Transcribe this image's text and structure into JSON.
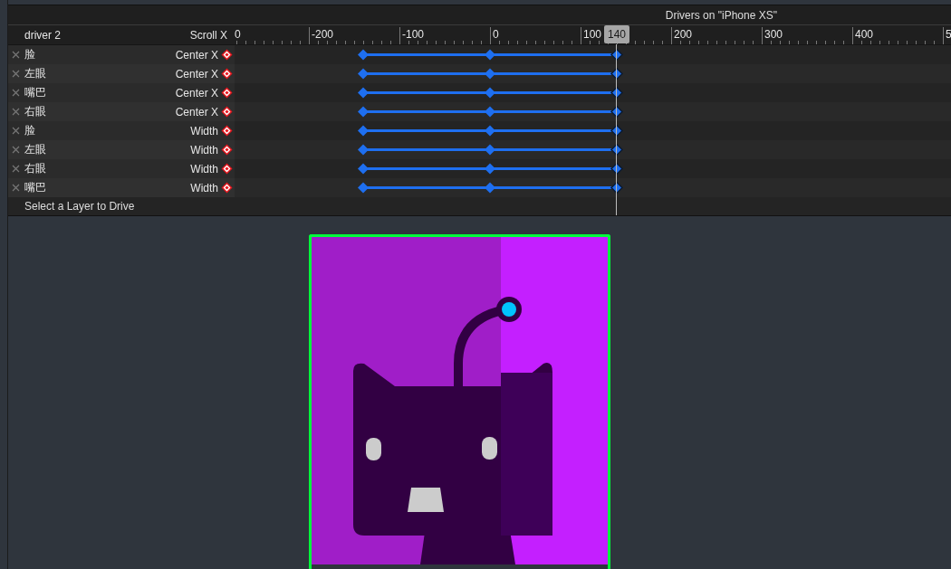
{
  "panel": {
    "title": "Drivers on \"iPhone XS\"",
    "driver": "driver 2",
    "driver_property": "Scroll X"
  },
  "ruler": {
    "labels": [
      "0",
      "-200",
      "-100",
      "0",
      "100",
      "200",
      "300",
      "400",
      "5"
    ],
    "playhead": "140"
  },
  "rows": [
    {
      "layer": "脸",
      "property": "Center X"
    },
    {
      "layer": "左眼",
      "property": "Center X"
    },
    {
      "layer": "嘴巴",
      "property": "Center X"
    },
    {
      "layer": "右眼",
      "property": "Center X"
    },
    {
      "layer": "脸",
      "property": "Width"
    },
    {
      "layer": "左眼",
      "property": "Width"
    },
    {
      "layer": "右眼",
      "property": "Width"
    },
    {
      "layer": "嘴巴",
      "property": "Width"
    }
  ],
  "footer": "Select a Layer to Drive"
}
